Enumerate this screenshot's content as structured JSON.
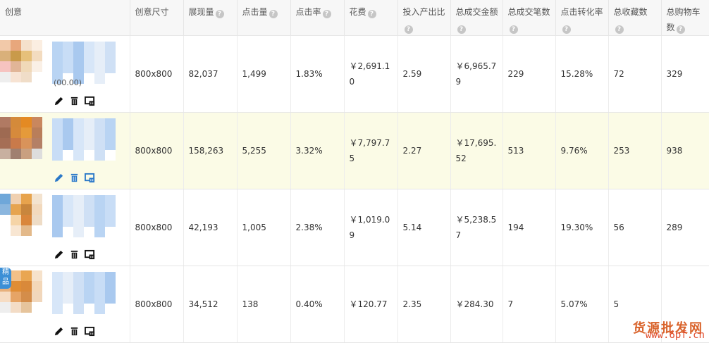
{
  "headers": [
    {
      "label": "创意",
      "help": false
    },
    {
      "label": "创意尺寸",
      "help": false
    },
    {
      "label": "展现量",
      "help": true
    },
    {
      "label": "点击量",
      "help": true
    },
    {
      "label": "点击率",
      "help": true
    },
    {
      "label": "花费",
      "help": true
    },
    {
      "label": "投入产出比",
      "help": true
    },
    {
      "label": "总成交金额",
      "help": true
    },
    {
      "label": "总成交笔数",
      "help": true
    },
    {
      "label": "点击转化率",
      "help": true
    },
    {
      "label": "总收藏数",
      "help": true
    },
    {
      "label": "总购物车数",
      "help": true
    }
  ],
  "help_glyph": "?",
  "rows": [
    {
      "size": "800x800",
      "impressions": "82,037",
      "clicks": "1,499",
      "ctr": "1.83%",
      "cost": "￥2,691.10",
      "roi": "2.59",
      "gmv": "￥6,965.79",
      "orders": "229",
      "cvr": "15.28%",
      "favorites": "72",
      "carts": "329",
      "highlight": false,
      "badge": "",
      "fragment": "(00.00)"
    },
    {
      "size": "800x800",
      "impressions": "158,263",
      "clicks": "5,255",
      "ctr": "3.32%",
      "cost": "￥7,797.75",
      "roi": "2.27",
      "gmv": "￥17,695.52",
      "orders": "513",
      "cvr": "9.76%",
      "favorites": "253",
      "carts": "938",
      "highlight": true,
      "badge": "",
      "fragment": ""
    },
    {
      "size": "800x800",
      "impressions": "42,193",
      "clicks": "1,005",
      "ctr": "2.38%",
      "cost": "￥1,019.09",
      "roi": "5.14",
      "gmv": "￥5,238.57",
      "orders": "194",
      "cvr": "19.30%",
      "favorites": "56",
      "carts": "289",
      "highlight": false,
      "badge": "",
      "fragment": ""
    },
    {
      "size": "800x800",
      "impressions": "34,512",
      "clicks": "138",
      "ctr": "0.40%",
      "cost": "￥120.77",
      "roi": "2.35",
      "gmv": "￥284.30",
      "orders": "7",
      "cvr": "5.07%",
      "favorites": "5",
      "carts": "",
      "highlight": false,
      "badge": "精品",
      "fragment": ""
    }
  ],
  "icons": [
    "edit-icon",
    "delete-icon",
    "preview-icon"
  ],
  "watermark": {
    "text": "货源批发网",
    "url": "www.6pf.cn"
  }
}
